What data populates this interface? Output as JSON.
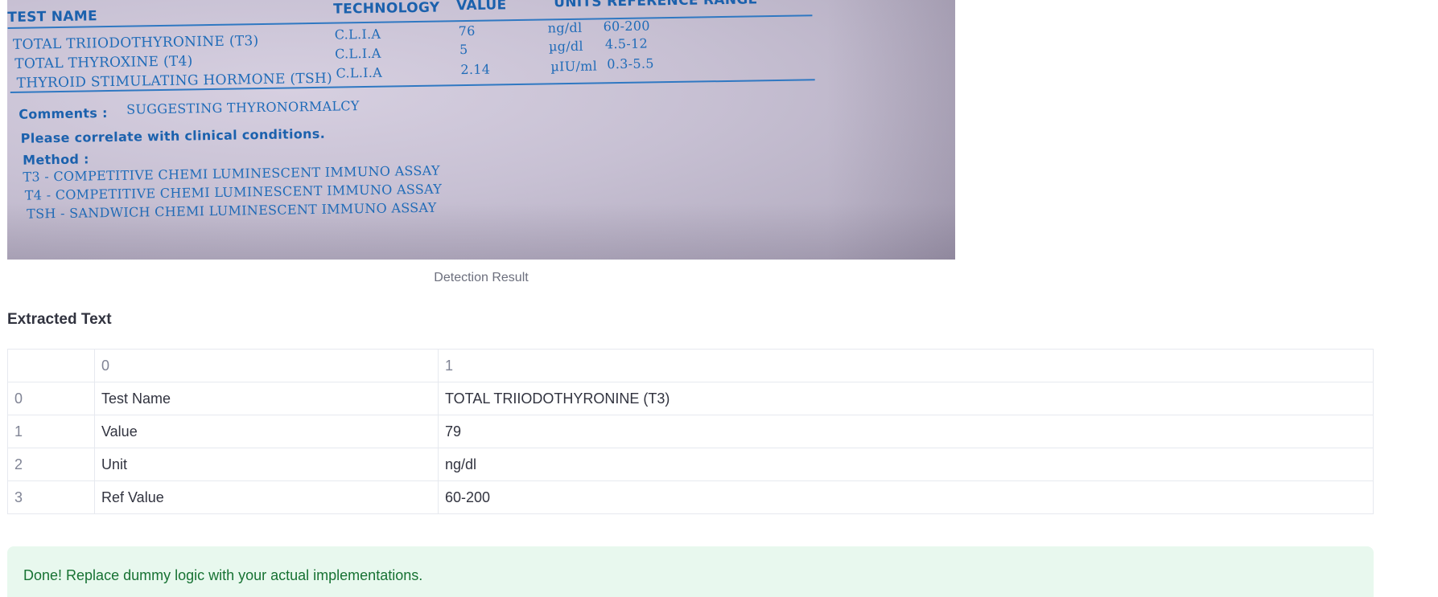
{
  "report_image": {
    "headers": {
      "test_name": "TEST NAME",
      "technology": "TECHNOLOGY",
      "value": "VALUE",
      "units_ref": "UNITS REFERENCE RANGE"
    },
    "rows": [
      {
        "name": "TOTAL TRIIODOTHYRONINE (T3)",
        "technology": "C.L.I.A",
        "value": "76",
        "unit": "ng/dl",
        "range": "60-200"
      },
      {
        "name": "TOTAL THYROXINE (T4)",
        "technology": "C.L.I.A",
        "value": "5",
        "unit": "µg/dl",
        "range": "4.5-12"
      },
      {
        "name": "THYROID STIMULATING HORMONE (TSH)",
        "technology": "C.L.I.A",
        "value": "2.14",
        "unit": "µIU/ml",
        "range": "0.3-5.5"
      }
    ],
    "comments_label": "Comments :",
    "comments_value": "SUGGESTING THYRONORMALCY",
    "correlate": "Please correlate with clinical conditions.",
    "method_label": "Method :",
    "methods": [
      "T3 - COMPETITIVE  CHEMI LUMINESCENT IMMUNO ASSAY",
      "T4 - COMPETITIVE CHEMI LUMINESCENT IMMUNO ASSAY",
      "TSH - SANDWICH CHEMI LUMINESCENT IMMUNO ASSAY"
    ]
  },
  "caption": "Detection Result",
  "section_title": "Extracted Text",
  "table": {
    "columns": [
      "0",
      "1"
    ],
    "rows": [
      {
        "index": "0",
        "c0": "Test Name",
        "c1": "TOTAL TRIIODOTHYRONINE (T3)"
      },
      {
        "index": "1",
        "c0": "Value",
        "c1": "79"
      },
      {
        "index": "2",
        "c0": "Unit",
        "c1": "ng/dl"
      },
      {
        "index": "3",
        "c0": "Ref Value",
        "c1": "60-200"
      }
    ]
  },
  "alert": {
    "message": "Done! Replace dummy logic with your actual implementations."
  }
}
